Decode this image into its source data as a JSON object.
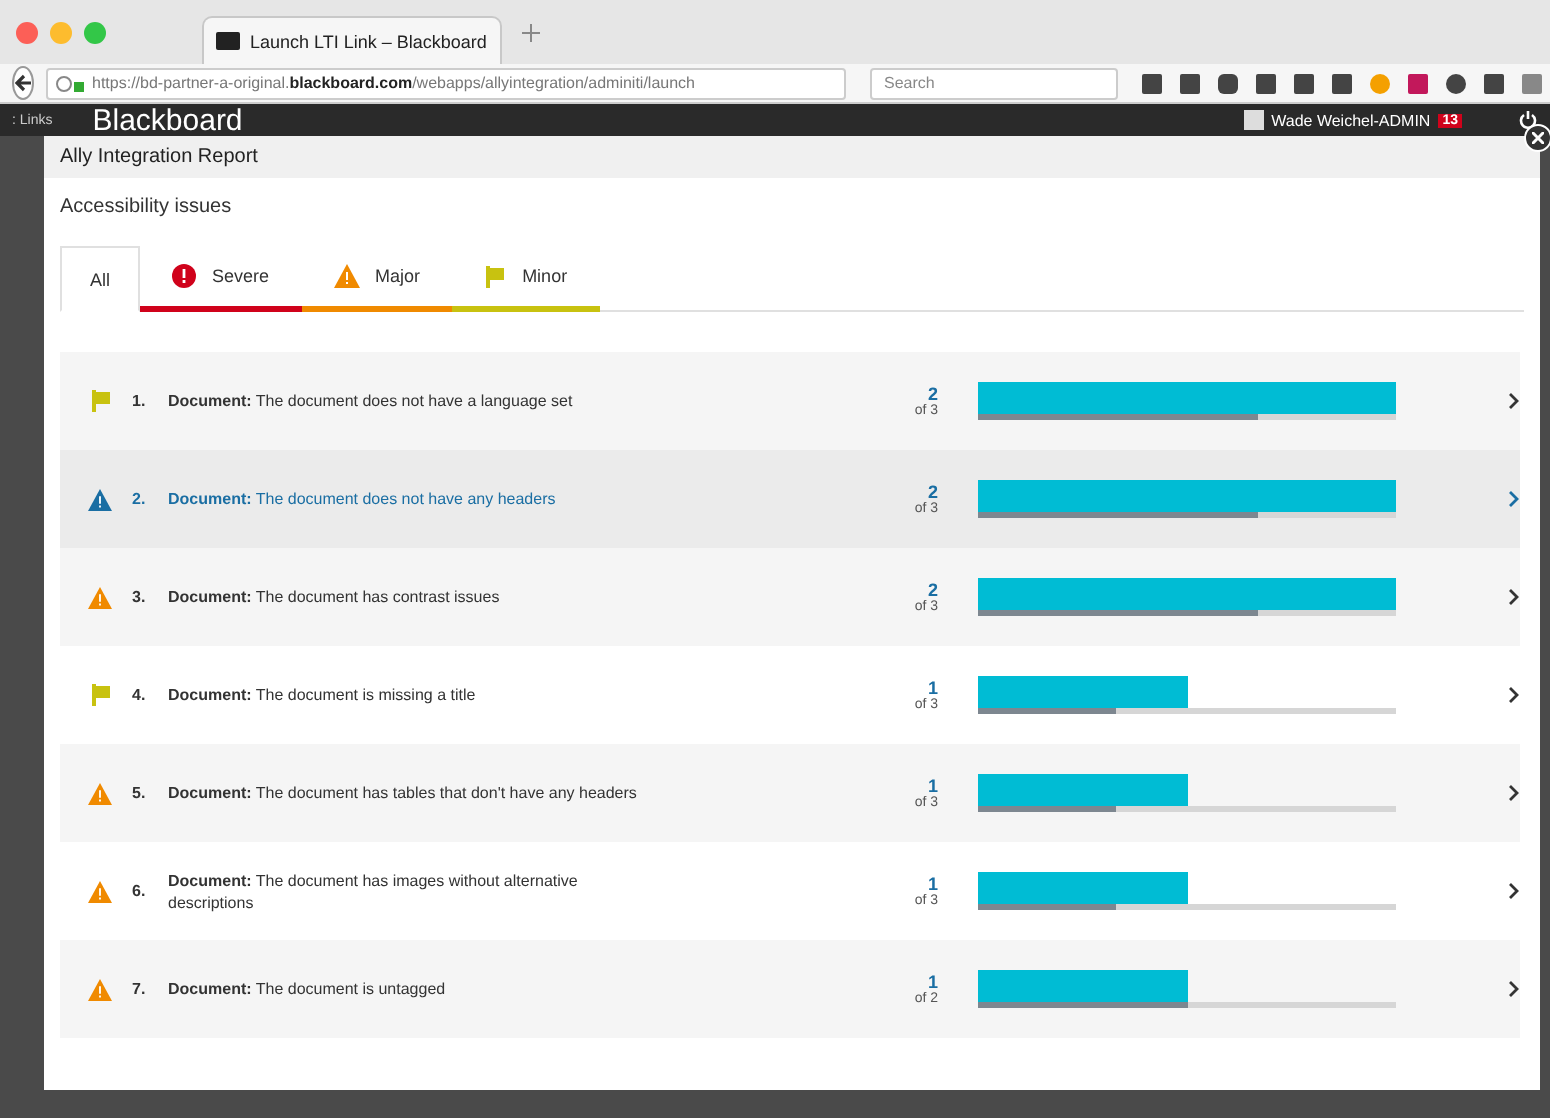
{
  "browser": {
    "tab_title": "Launch LTI Link – Blackboard",
    "url": "https://bd-partner-a-original.**blackboard.com**/webapps/allyintegration/adminiti/launch",
    "search": {
      "placeholder": "Search"
    }
  },
  "lms_bar": {
    "links": ": Links",
    "logo": "Blackboard",
    "user": "Wade Weichel-ADMIN",
    "badge": "13"
  },
  "modal": {
    "title": "Ally Integration Report",
    "heading": "Accessibility issues",
    "tabs": [
      {
        "label": "All",
        "kind": "all",
        "selected": true
      },
      {
        "label": "Severe",
        "kind": "severe",
        "selected": false
      },
      {
        "label": "Major",
        "kind": "major",
        "selected": false
      },
      {
        "label": "Minor",
        "kind": "minor",
        "selected": false
      }
    ],
    "issues": [
      {
        "number": "1.",
        "kind": "minor",
        "selected": false,
        "type": "Document:",
        "text": "The document does not have a language set",
        "count": "2",
        "total": "of 3",
        "bar": {
          "level": 1
        },
        "baseline": {
          "level": 0.67
        }
      },
      {
        "number": "2.",
        "kind": "major",
        "selected": true,
        "type": "Document:",
        "text": "The document does not have any headers",
        "count": "2",
        "total": "of 3",
        "bar": {
          "level": 1
        },
        "baseline": {
          "level": 0.67
        }
      },
      {
        "number": "3.",
        "kind": "major",
        "selected": false,
        "type": "Document:",
        "text": "The document has contrast issues",
        "count": "2",
        "total": "of 3",
        "bar": {
          "level": 1
        },
        "baseline": {
          "level": 0.67
        }
      },
      {
        "number": "4.",
        "kind": "minor",
        "selected": false,
        "type": "Document:",
        "text": "The document is missing a title",
        "count": "1",
        "total": "of 3",
        "bar": {
          "level": 0.5
        },
        "baseline": {
          "level": 0.33
        }
      },
      {
        "number": "5.",
        "kind": "major",
        "selected": false,
        "type": "Document:",
        "text": "The document has tables that don't have any headers",
        "count": "1",
        "total": "of 3",
        "bar": {
          "level": 0.5
        },
        "baseline": {
          "level": 0.33
        }
      },
      {
        "number": "6.",
        "kind": "major",
        "selected": false,
        "type": "Document:",
        "text": "The document has images without alternative descriptions",
        "count": "1",
        "total": "of 3",
        "bar": {
          "level": 0.5
        },
        "baseline": {
          "level": 0.33
        }
      },
      {
        "number": "7.",
        "kind": "major",
        "selected": false,
        "type": "Document:",
        "text": "The document is untagged",
        "count": "1",
        "total": "of 2",
        "bar": {
          "level": 0.5
        },
        "baseline": {
          "level": 0.5
        }
      }
    ]
  }
}
